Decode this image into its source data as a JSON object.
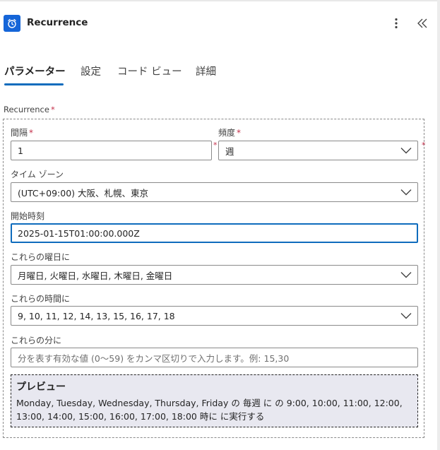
{
  "header": {
    "title": "Recurrence",
    "app_icon": "alarm-clock-icon",
    "accent": "#1565d8"
  },
  "tabs": [
    {
      "label": "パラメーター",
      "active": true
    },
    {
      "label": "設定",
      "active": false
    },
    {
      "label": "コード ビュー",
      "active": false
    },
    {
      "label": "詳細",
      "active": false
    }
  ],
  "form": {
    "section_label": "Recurrence",
    "required_mark": "*",
    "interval": {
      "label": "間隔",
      "value": "1"
    },
    "frequency": {
      "label": "頻度",
      "value": "週"
    },
    "timezone": {
      "label": "タイム ゾーン",
      "value": "(UTC+09:00) 大阪、札幌、東京"
    },
    "start_time": {
      "label": "開始時刻",
      "value": "2025-01-15T01:00:00.000Z"
    },
    "weekdays": {
      "label": "これらの曜日に",
      "value": "月曜日, 火曜日, 水曜日, 木曜日, 金曜日"
    },
    "hours": {
      "label": "これらの時間に",
      "value": "9, 10, 11, 12, 14, 13, 15, 16, 17, 18"
    },
    "minutes": {
      "label": "これらの分に",
      "placeholder": "分を表す有効な値 (0〜59) をカンマ区切りで入力します。例: 15,30"
    }
  },
  "preview": {
    "title": "プレビュー",
    "text": "Monday, Tuesday, Wednesday, Thursday, Friday の 毎週 に の 9:00, 10:00, 11:00, 12:00, 13:00, 14:00, 15:00, 16:00, 17:00, 18:00 時に に実行する"
  }
}
